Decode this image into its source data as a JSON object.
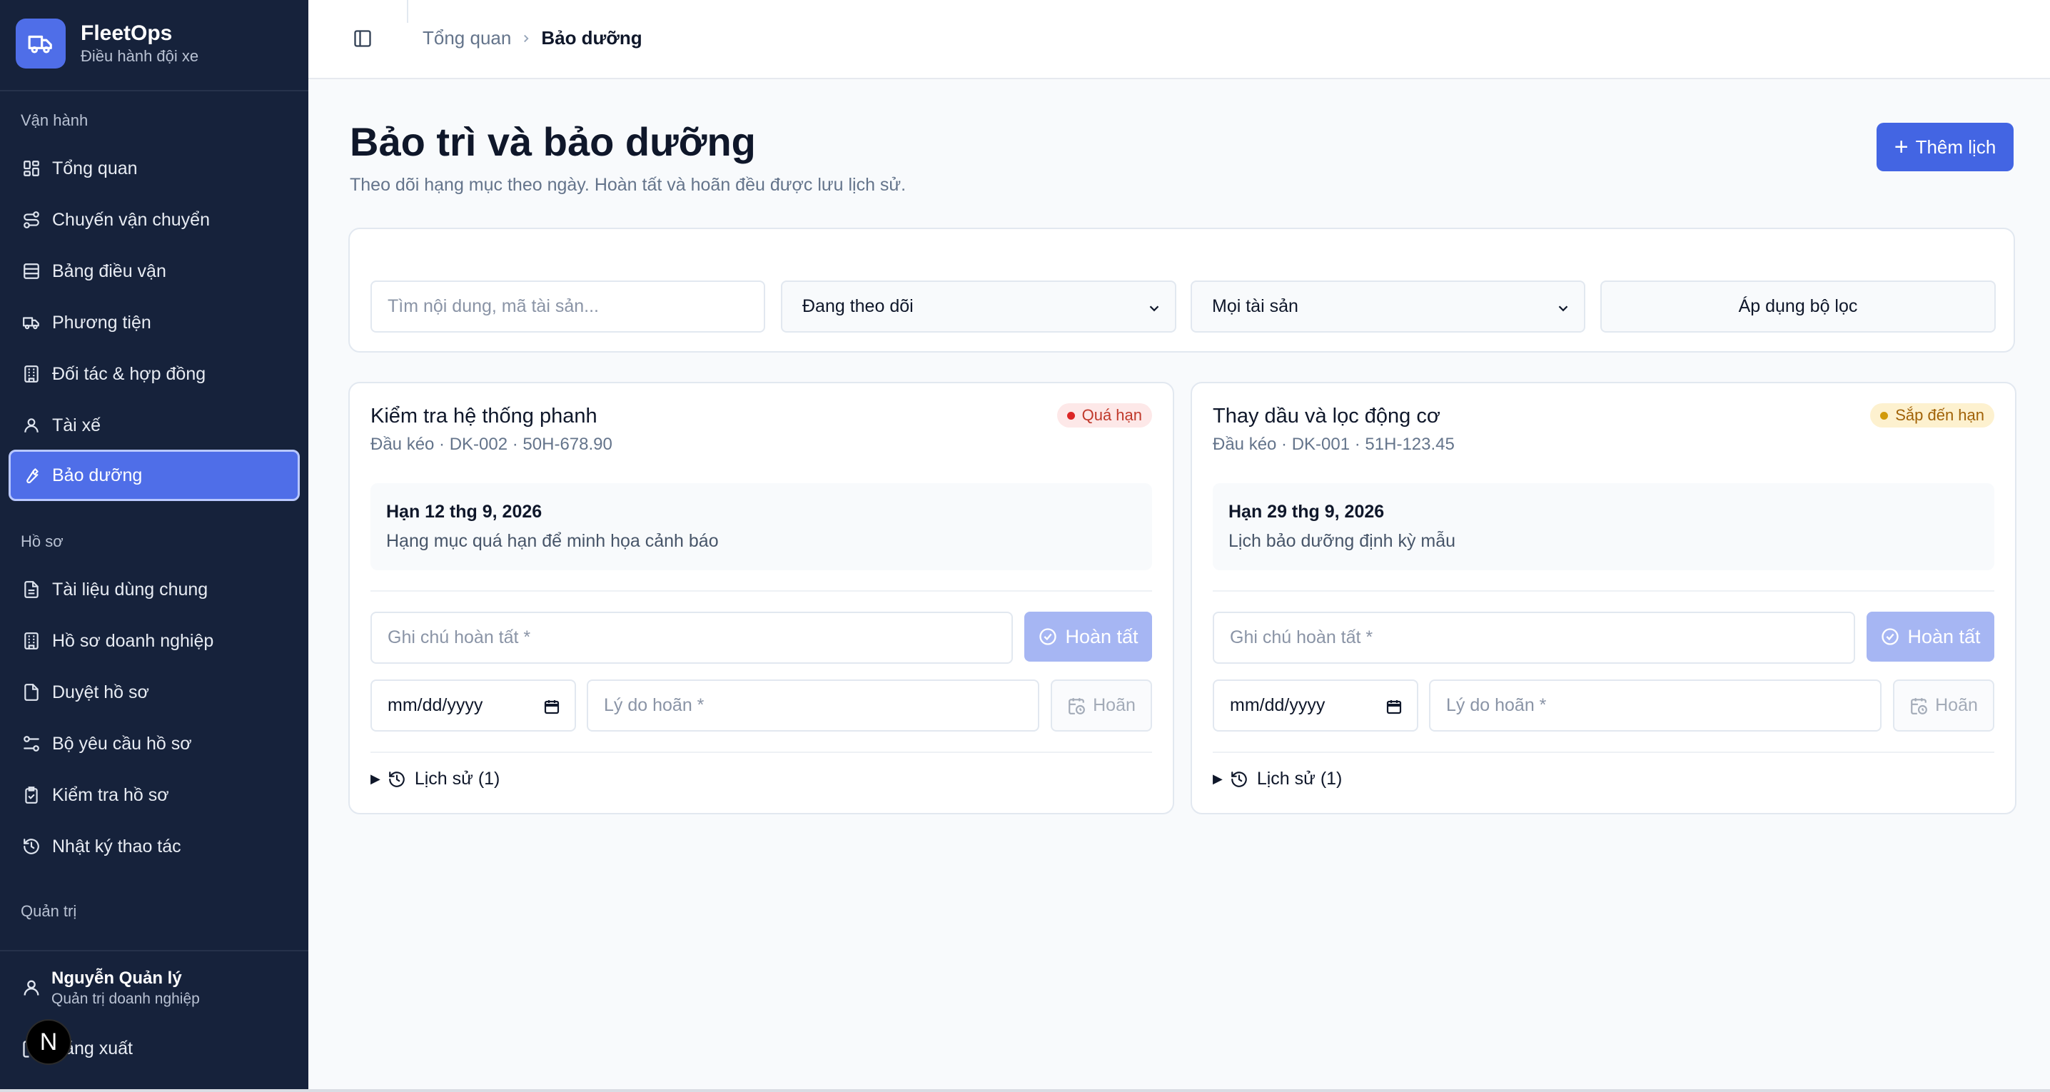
{
  "app": {
    "name": "FleetOps",
    "subtitle": "Điều hành đội xe"
  },
  "sidebar": {
    "sections": [
      {
        "label": "Vận hành"
      },
      {
        "label": "Hồ sơ"
      },
      {
        "label": "Quản trị"
      }
    ],
    "items": [
      {
        "label": "Tổng quan",
        "icon": "dashboard-icon"
      },
      {
        "label": "Chuyến vận chuyển",
        "icon": "route-icon"
      },
      {
        "label": "Bảng điều vận",
        "icon": "table-icon"
      },
      {
        "label": "Phương tiện",
        "icon": "truck-icon"
      },
      {
        "label": "Đối tác & hợp đồng",
        "icon": "building-icon"
      },
      {
        "label": "Tài xế",
        "icon": "user-icon"
      },
      {
        "label": "Bảo dưỡng",
        "icon": "wrench-icon",
        "active": true
      },
      {
        "label": "Tài liệu dùng chung",
        "icon": "document-icon"
      },
      {
        "label": "Hồ sơ doanh nghiệp",
        "icon": "building-icon"
      },
      {
        "label": "Duyệt hồ sơ",
        "icon": "file-check-icon"
      },
      {
        "label": "Bộ yêu cầu hồ sơ",
        "icon": "sliders-icon"
      },
      {
        "label": "Kiểm tra hồ sơ",
        "icon": "clipboard-check-icon"
      },
      {
        "label": "Nhật ký thao tác",
        "icon": "history-icon"
      }
    ],
    "user": {
      "name": "Nguyễn Quản lý",
      "role": "Quản trị doanh nghiệp"
    },
    "logout_label": "Đăng xuất",
    "dev_badge": "N"
  },
  "breadcrumb": {
    "parent": "Tổng quan",
    "current": "Bảo dưỡng"
  },
  "page": {
    "title": "Bảo trì và bảo dưỡng",
    "subtitle": "Theo dõi hạng mục theo ngày. Hoàn tất và hoãn đều được lưu lịch sử.",
    "add_button": "Thêm lịch"
  },
  "filters": {
    "search_placeholder": "Tìm nội dung, mã tài sản...",
    "status_selected": "Đang theo dõi",
    "asset_selected": "Mọi tài sản",
    "apply_button": "Áp dụng bộ lọc"
  },
  "cards": [
    {
      "title": "Kiểm tra hệ thống phanh",
      "meta": "Đầu kéo · DK-002 · 50H-678.90",
      "badge": "Quá hạn",
      "badge_color": "#dc2626",
      "due": "Hạn 12 thg 9, 2026",
      "description": "Hạng mục quá hạn để minh họa cảnh báo",
      "note_placeholder": "Ghi chú hoàn tất *",
      "done_button": "Hoàn tất",
      "date_placeholder": "mm/dd/yyyy",
      "reason_placeholder": "Lý do hoãn *",
      "postpone_button": "Hoãn",
      "history": "Lịch sử (1)"
    },
    {
      "title": "Thay dầu và lọc động cơ",
      "meta": "Đầu kéo · DK-001 · 51H-123.45",
      "badge": "Sắp đến hạn",
      "badge_color": "#d19a0b",
      "due": "Hạn 29 thg 9, 2026",
      "description": "Lịch bảo dưỡng định kỳ mẫu",
      "note_placeholder": "Ghi chú hoàn tất *",
      "done_button": "Hoàn tất",
      "date_placeholder": "mm/dd/yyyy",
      "reason_placeholder": "Lý do hoãn *",
      "postpone_button": "Hoãn",
      "history": "Lịch sử (1)"
    }
  ],
  "colors": {
    "sidebar_bg": "#16223b",
    "accent": "#4365e3",
    "danger": "#dc2626",
    "warning": "#d19a0b"
  }
}
